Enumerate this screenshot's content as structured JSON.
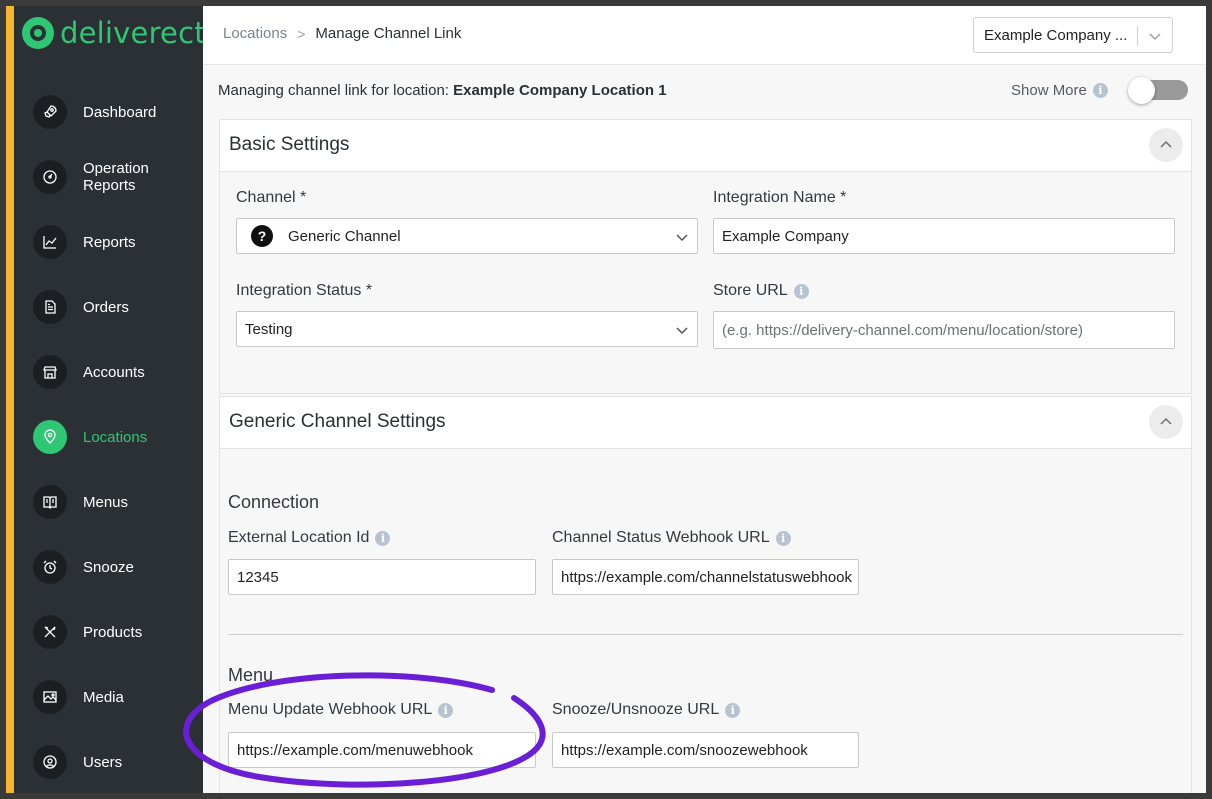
{
  "brand": {
    "name": "deliverect",
    "accent_color": "#2fc774",
    "sidebar_stripe_color": "#f5b730"
  },
  "sidebar": {
    "items": [
      {
        "label": "Dashboard",
        "icon": "rocket-icon",
        "active": false
      },
      {
        "label": "Operation Reports",
        "icon": "gauge-icon",
        "active": false
      },
      {
        "label": "Reports",
        "icon": "chart-line-icon",
        "active": false
      },
      {
        "label": "Orders",
        "icon": "document-icon",
        "active": false
      },
      {
        "label": "Accounts",
        "icon": "store-icon",
        "active": false
      },
      {
        "label": "Locations",
        "icon": "location-pin-icon",
        "active": true
      },
      {
        "label": "Menus",
        "icon": "book-icon",
        "active": false
      },
      {
        "label": "Snooze",
        "icon": "alarm-clock-icon",
        "active": false
      },
      {
        "label": "Products",
        "icon": "utensils-icon",
        "active": false
      },
      {
        "label": "Media",
        "icon": "image-icon",
        "active": false
      },
      {
        "label": "Users",
        "icon": "user-circle-icon",
        "active": false
      }
    ]
  },
  "topbar": {
    "breadcrumb": {
      "parent": "Locations",
      "separator": ">",
      "current": "Manage Channel Link"
    },
    "company_select": {
      "value": "Example Company ..."
    }
  },
  "location_bar": {
    "prefix": "Managing channel link for location:",
    "location_name": "Example Company Location 1",
    "show_more_label": "Show More",
    "show_more_enabled": false
  },
  "basic_settings": {
    "title": "Basic Settings",
    "channel": {
      "label": "Channel *",
      "value": "Generic Channel",
      "icon_glyph": "?"
    },
    "integration_name": {
      "label": "Integration Name *",
      "value": "Example Company"
    },
    "integration_status": {
      "label": "Integration Status *",
      "value": "Testing"
    },
    "store_url": {
      "label": "Store URL",
      "placeholder": "(e.g. https://delivery-channel.com/menu/location/store)",
      "value": ""
    }
  },
  "generic_settings": {
    "title": "Generic Channel Settings",
    "connection": {
      "heading": "Connection",
      "external_location_id": {
        "label": "External Location Id",
        "value": "12345"
      },
      "channel_status_webhook": {
        "label": "Channel Status Webhook URL",
        "value": "https://example.com/channelstatuswebhook"
      }
    },
    "menu": {
      "heading": "Menu",
      "menu_update_webhook": {
        "label": "Menu Update Webhook URL",
        "value": "https://example.com/menuwebhook"
      },
      "snooze_url": {
        "label": "Snooze/Unsnooze URL",
        "value": "https://example.com/snoozewebhook"
      }
    }
  },
  "annotation": {
    "color": "#6a1fd6"
  }
}
